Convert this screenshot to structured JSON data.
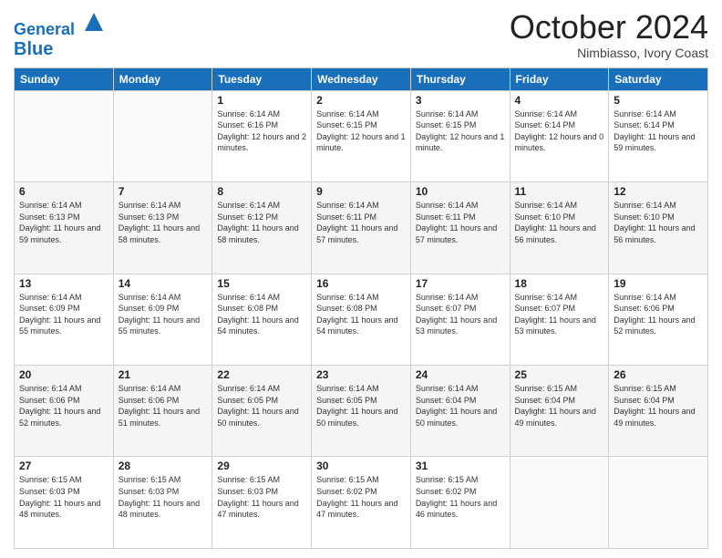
{
  "header": {
    "logo_line1": "General",
    "logo_line2": "Blue",
    "month": "October 2024",
    "location": "Nimbiasso, Ivory Coast"
  },
  "days_of_week": [
    "Sunday",
    "Monday",
    "Tuesday",
    "Wednesday",
    "Thursday",
    "Friday",
    "Saturday"
  ],
  "weeks": [
    [
      {
        "day": "",
        "info": ""
      },
      {
        "day": "",
        "info": ""
      },
      {
        "day": "1",
        "info": "Sunrise: 6:14 AM\nSunset: 6:16 PM\nDaylight: 12 hours and 2 minutes."
      },
      {
        "day": "2",
        "info": "Sunrise: 6:14 AM\nSunset: 6:15 PM\nDaylight: 12 hours and 1 minute."
      },
      {
        "day": "3",
        "info": "Sunrise: 6:14 AM\nSunset: 6:15 PM\nDaylight: 12 hours and 1 minute."
      },
      {
        "day": "4",
        "info": "Sunrise: 6:14 AM\nSunset: 6:14 PM\nDaylight: 12 hours and 0 minutes."
      },
      {
        "day": "5",
        "info": "Sunrise: 6:14 AM\nSunset: 6:14 PM\nDaylight: 11 hours and 59 minutes."
      }
    ],
    [
      {
        "day": "6",
        "info": "Sunrise: 6:14 AM\nSunset: 6:13 PM\nDaylight: 11 hours and 59 minutes."
      },
      {
        "day": "7",
        "info": "Sunrise: 6:14 AM\nSunset: 6:13 PM\nDaylight: 11 hours and 58 minutes."
      },
      {
        "day": "8",
        "info": "Sunrise: 6:14 AM\nSunset: 6:12 PM\nDaylight: 11 hours and 58 minutes."
      },
      {
        "day": "9",
        "info": "Sunrise: 6:14 AM\nSunset: 6:11 PM\nDaylight: 11 hours and 57 minutes."
      },
      {
        "day": "10",
        "info": "Sunrise: 6:14 AM\nSunset: 6:11 PM\nDaylight: 11 hours and 57 minutes."
      },
      {
        "day": "11",
        "info": "Sunrise: 6:14 AM\nSunset: 6:10 PM\nDaylight: 11 hours and 56 minutes."
      },
      {
        "day": "12",
        "info": "Sunrise: 6:14 AM\nSunset: 6:10 PM\nDaylight: 11 hours and 56 minutes."
      }
    ],
    [
      {
        "day": "13",
        "info": "Sunrise: 6:14 AM\nSunset: 6:09 PM\nDaylight: 11 hours and 55 minutes."
      },
      {
        "day": "14",
        "info": "Sunrise: 6:14 AM\nSunset: 6:09 PM\nDaylight: 11 hours and 55 minutes."
      },
      {
        "day": "15",
        "info": "Sunrise: 6:14 AM\nSunset: 6:08 PM\nDaylight: 11 hours and 54 minutes."
      },
      {
        "day": "16",
        "info": "Sunrise: 6:14 AM\nSunset: 6:08 PM\nDaylight: 11 hours and 54 minutes."
      },
      {
        "day": "17",
        "info": "Sunrise: 6:14 AM\nSunset: 6:07 PM\nDaylight: 11 hours and 53 minutes."
      },
      {
        "day": "18",
        "info": "Sunrise: 6:14 AM\nSunset: 6:07 PM\nDaylight: 11 hours and 53 minutes."
      },
      {
        "day": "19",
        "info": "Sunrise: 6:14 AM\nSunset: 6:06 PM\nDaylight: 11 hours and 52 minutes."
      }
    ],
    [
      {
        "day": "20",
        "info": "Sunrise: 6:14 AM\nSunset: 6:06 PM\nDaylight: 11 hours and 52 minutes."
      },
      {
        "day": "21",
        "info": "Sunrise: 6:14 AM\nSunset: 6:06 PM\nDaylight: 11 hours and 51 minutes."
      },
      {
        "day": "22",
        "info": "Sunrise: 6:14 AM\nSunset: 6:05 PM\nDaylight: 11 hours and 50 minutes."
      },
      {
        "day": "23",
        "info": "Sunrise: 6:14 AM\nSunset: 6:05 PM\nDaylight: 11 hours and 50 minutes."
      },
      {
        "day": "24",
        "info": "Sunrise: 6:14 AM\nSunset: 6:04 PM\nDaylight: 11 hours and 50 minutes."
      },
      {
        "day": "25",
        "info": "Sunrise: 6:15 AM\nSunset: 6:04 PM\nDaylight: 11 hours and 49 minutes."
      },
      {
        "day": "26",
        "info": "Sunrise: 6:15 AM\nSunset: 6:04 PM\nDaylight: 11 hours and 49 minutes."
      }
    ],
    [
      {
        "day": "27",
        "info": "Sunrise: 6:15 AM\nSunset: 6:03 PM\nDaylight: 11 hours and 48 minutes."
      },
      {
        "day": "28",
        "info": "Sunrise: 6:15 AM\nSunset: 6:03 PM\nDaylight: 11 hours and 48 minutes."
      },
      {
        "day": "29",
        "info": "Sunrise: 6:15 AM\nSunset: 6:03 PM\nDaylight: 11 hours and 47 minutes."
      },
      {
        "day": "30",
        "info": "Sunrise: 6:15 AM\nSunset: 6:02 PM\nDaylight: 11 hours and 47 minutes."
      },
      {
        "day": "31",
        "info": "Sunrise: 6:15 AM\nSunset: 6:02 PM\nDaylight: 11 hours and 46 minutes."
      },
      {
        "day": "",
        "info": ""
      },
      {
        "day": "",
        "info": ""
      }
    ]
  ]
}
